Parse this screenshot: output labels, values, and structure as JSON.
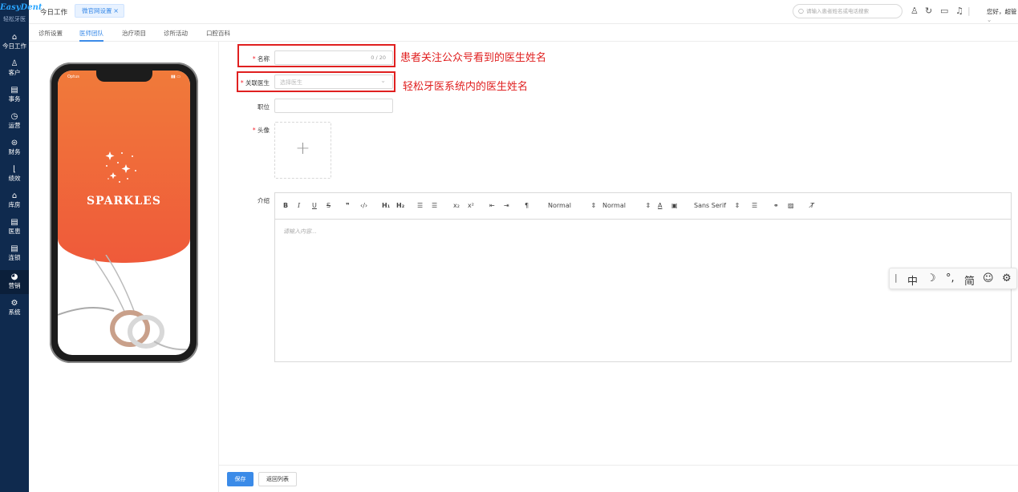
{
  "app": {
    "logo": "EasyDent",
    "logo_sub": "轻松牙医"
  },
  "sidebar": {
    "items": [
      {
        "label": "今日工作",
        "icon": "home-icon"
      },
      {
        "label": "客户",
        "icon": "user-icon"
      },
      {
        "label": "事务",
        "icon": "task-icon"
      },
      {
        "label": "运营",
        "icon": "clock-icon"
      },
      {
        "label": "财务",
        "icon": "money-icon"
      },
      {
        "label": "绩效",
        "icon": "chart-icon"
      },
      {
        "label": "库房",
        "icon": "warehouse-icon"
      },
      {
        "label": "医患",
        "icon": "doc-icon"
      },
      {
        "label": "连锁",
        "icon": "chain-icon"
      },
      {
        "label": "营销",
        "icon": "marketing-icon"
      },
      {
        "label": "系统",
        "icon": "gear-icon"
      }
    ],
    "active": "营销"
  },
  "topbar": {
    "home_tab": "今日工作",
    "active_tab": "微官网设置",
    "search_placeholder": "请输入患者姓名或电话搜索",
    "user": "您好，超管"
  },
  "subtabs": [
    "诊所设置",
    "医师团队",
    "治疗项目",
    "诊所活动",
    "口腔百科"
  ],
  "active_subtab": "医师团队",
  "preview": {
    "carrier": "Optus",
    "brand": "SPARKLES"
  },
  "form": {
    "name_label": "名称",
    "name_counter": "0 / 20",
    "doctor_label": "关联医生",
    "doctor_placeholder": "选择医生",
    "position_label": "职位",
    "avatar_label": "头像",
    "intro_label": "介绍",
    "editor_placeholder": "请输入内容..."
  },
  "annotations": {
    "name_note": "患者关注公众号看到的医生姓名",
    "doctor_note": "轻松牙医系统内的医生姓名"
  },
  "toolbar": {
    "header1": "H₁",
    "header2": "H₂",
    "size_select": "Normal",
    "header_select": "Normal",
    "font_select": "Sans Serif"
  },
  "ime": {
    "lang": "中",
    "mode": "简"
  },
  "footer": {
    "save": "保存",
    "back": "返回列表"
  },
  "colors": {
    "primary": "#3b8be8",
    "sidebar": "#0f2a4e",
    "annotation": "#e02020"
  }
}
